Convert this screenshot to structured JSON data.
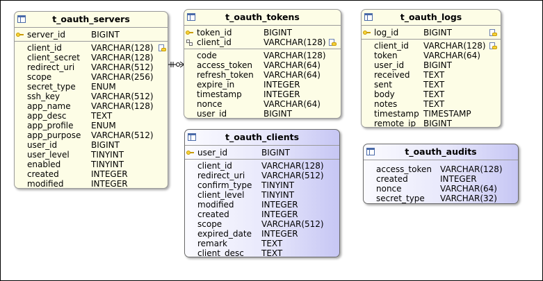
{
  "tables": {
    "servers": {
      "name": "t_oauth_servers",
      "pk": [
        {
          "name": "server_id",
          "type": "BIGINT",
          "key": "pk"
        }
      ],
      "columns": [
        {
          "name": "client_id",
          "type": "VARCHAR(128)",
          "idx": true
        },
        {
          "name": "client_secret",
          "type": "VARCHAR(128)"
        },
        {
          "name": "redirect_uri",
          "type": "VARCHAR(512)"
        },
        {
          "name": "scope",
          "type": "VARCHAR(256)"
        },
        {
          "name": "secret_type",
          "type": "ENUM"
        },
        {
          "name": "ssh_key",
          "type": "VARCHAR(512)"
        },
        {
          "name": "app_name",
          "type": "VARCHAR(128)"
        },
        {
          "name": "app_desc",
          "type": "TEXT"
        },
        {
          "name": "app_profile",
          "type": "ENUM"
        },
        {
          "name": "app_purpose",
          "type": "VARCHAR(512)"
        },
        {
          "name": "user_id",
          "type": "BIGINT"
        },
        {
          "name": "user_level",
          "type": "TINYINT"
        },
        {
          "name": "enabled",
          "type": "TINYINT"
        },
        {
          "name": "created",
          "type": "INTEGER"
        },
        {
          "name": "modified",
          "type": "INTEGER"
        }
      ]
    },
    "tokens": {
      "name": "t_oauth_tokens",
      "pk": [
        {
          "name": "token_id",
          "type": "BIGINT",
          "key": "pk"
        },
        {
          "name": "client_id",
          "type": "VARCHAR(128)",
          "key": "fk",
          "idx": true
        }
      ],
      "columns": [
        {
          "name": "code",
          "type": "VARCHAR(128)"
        },
        {
          "name": "access_token",
          "type": "VARCHAR(64)"
        },
        {
          "name": "refresh_token",
          "type": "VARCHAR(64)"
        },
        {
          "name": "expire_in",
          "type": "INTEGER"
        },
        {
          "name": "timestamp",
          "type": "INTEGER"
        },
        {
          "name": "nonce",
          "type": "VARCHAR(64)"
        },
        {
          "name": "user_id",
          "type": "BIGINT"
        }
      ]
    },
    "logs": {
      "name": "t_oauth_logs",
      "pk": [
        {
          "name": "log_id",
          "type": "BIGINT",
          "key": "pk",
          "idx": true
        }
      ],
      "columns": [
        {
          "name": "client_id",
          "type": "VARCHAR(128)",
          "idx": true
        },
        {
          "name": "token",
          "type": "VARCHAR(64)"
        },
        {
          "name": "user_id",
          "type": "BIGINT"
        },
        {
          "name": "received",
          "type": "TEXT"
        },
        {
          "name": "sent",
          "type": "TEXT"
        },
        {
          "name": "body",
          "type": "TEXT"
        },
        {
          "name": "notes",
          "type": "TEXT"
        },
        {
          "name": "timestamp",
          "type": "TIMESTAMP"
        },
        {
          "name": "remote_ip",
          "type": "BIGINT"
        }
      ]
    },
    "clients": {
      "name": "t_oauth_clients",
      "pk": [
        {
          "name": "user_id",
          "type": "BIGINT",
          "key": "pk"
        }
      ],
      "columns": [
        {
          "name": "client_id",
          "type": "VARCHAR(128)"
        },
        {
          "name": "redirect_uri",
          "type": "VARCHAR(512)"
        },
        {
          "name": "confirm_type",
          "type": "TINYINT"
        },
        {
          "name": "client_level",
          "type": "TINYINT"
        },
        {
          "name": "modified",
          "type": "INTEGER"
        },
        {
          "name": "created",
          "type": "INTEGER"
        },
        {
          "name": "scope",
          "type": "VARCHAR(512)"
        },
        {
          "name": "expired_date",
          "type": "INTEGER"
        },
        {
          "name": "remark",
          "type": "TEXT"
        },
        {
          "name": "client_desc",
          "type": "TEXT"
        }
      ]
    },
    "audits": {
      "name": "t_oauth_audits",
      "pk": [],
      "columns": [
        {
          "name": "access_token",
          "type": "VARCHAR(128)"
        },
        {
          "name": "created",
          "type": "INTEGER"
        },
        {
          "name": "nonce",
          "type": "VARCHAR(64)"
        },
        {
          "name": "secret_type",
          "type": "VARCHAR(32)"
        }
      ]
    }
  },
  "relationships": [
    {
      "from": "t_oauth_servers",
      "to": "t_oauth_tokens",
      "from_card": "one",
      "to_card": "many"
    }
  ]
}
